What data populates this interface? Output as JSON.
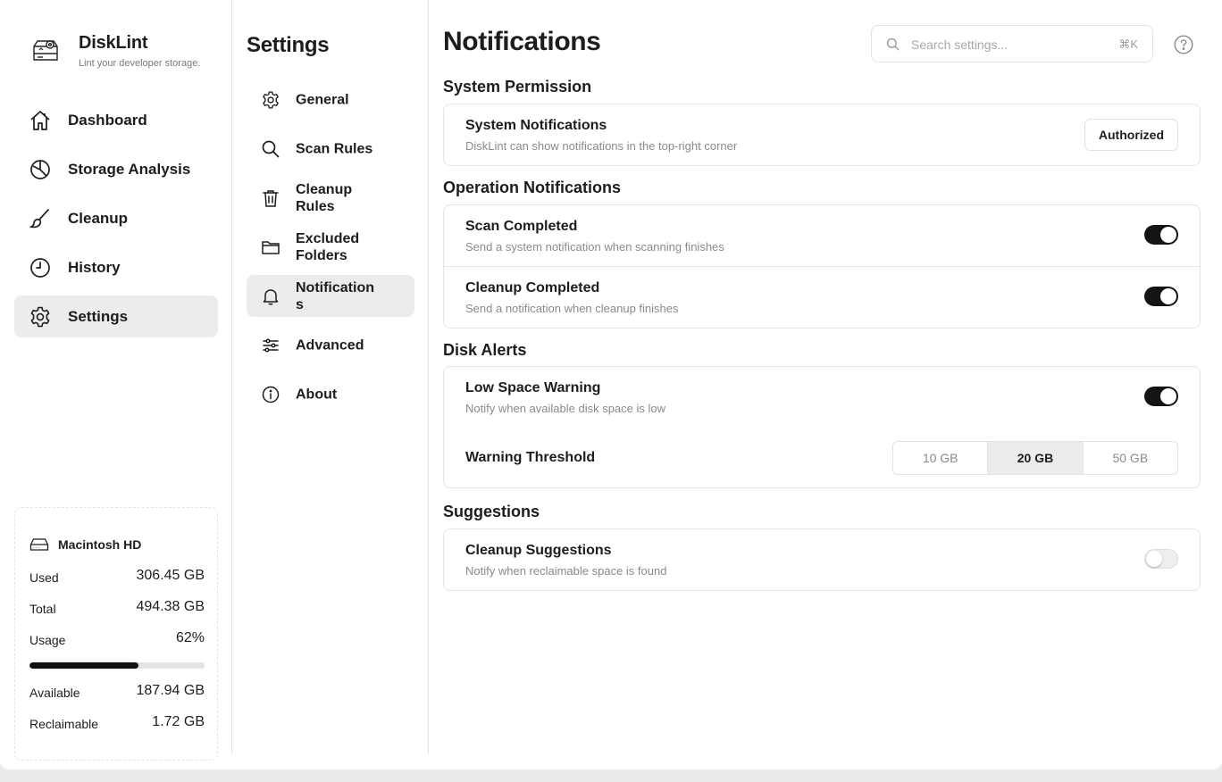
{
  "app": {
    "name": "DiskLint",
    "tagline": "Lint your developer storage."
  },
  "sidebar": {
    "items": [
      {
        "label": "Dashboard",
        "icon": "home-icon"
      },
      {
        "label": "Storage Analysis",
        "icon": "pie-chart-icon"
      },
      {
        "label": "Cleanup",
        "icon": "brush-icon"
      },
      {
        "label": "History",
        "icon": "clock-icon"
      },
      {
        "label": "Settings",
        "icon": "gear-icon",
        "active": true
      }
    ]
  },
  "disk": {
    "name": "Macintosh HD",
    "used_label": "Used",
    "used": "306.45 GB",
    "total_label": "Total",
    "total": "494.38 GB",
    "usage_label": "Usage",
    "usage": "62%",
    "usage_fraction": 0.62,
    "available_label": "Available",
    "available": "187.94 GB",
    "reclaimable_label": "Reclaimable",
    "reclaimable": "1.72 GB"
  },
  "settings_menu": {
    "title": "Settings",
    "items": [
      {
        "label": "General",
        "icon": "gear-icon"
      },
      {
        "label": "Scan Rules",
        "icon": "search-icon"
      },
      {
        "label": "Cleanup Rules",
        "icon": "trash-icon"
      },
      {
        "label": "Excluded Folders",
        "icon": "folder-icon"
      },
      {
        "label": "Notification s",
        "icon": "bell-icon",
        "active": true
      },
      {
        "label": "Advanced",
        "icon": "sliders-icon"
      },
      {
        "label": "About",
        "icon": "info-icon"
      }
    ]
  },
  "main": {
    "title": "Notifications",
    "search": {
      "placeholder": "Search settings...",
      "value": "",
      "shortcut": "⌘K"
    },
    "sections": {
      "system_permission": {
        "title": "System Permission",
        "rows": [
          {
            "title": "System Notifications",
            "desc": "DiskLint can show notifications in the top-right corner",
            "button": "Authorized"
          }
        ]
      },
      "operation": {
        "title": "Operation Notifications",
        "rows": [
          {
            "title": "Scan Completed",
            "desc": "Send a system notification when scanning finishes",
            "enabled": true
          },
          {
            "title": "Cleanup Completed",
            "desc": "Send a notification when cleanup finishes",
            "enabled": true
          }
        ]
      },
      "disk_alerts": {
        "title": "Disk Alerts",
        "low_space": {
          "title": "Low Space Warning",
          "desc": "Notify when available disk space is low",
          "enabled": true
        },
        "threshold": {
          "label": "Warning Threshold",
          "options": [
            "10 GB",
            "20 GB",
            "50 GB"
          ],
          "selected": "20 GB"
        }
      },
      "suggestions": {
        "title": "Suggestions",
        "rows": [
          {
            "title": "Cleanup Suggestions",
            "desc": "Notify when reclaimable space is found",
            "enabled": false
          }
        ]
      }
    }
  }
}
